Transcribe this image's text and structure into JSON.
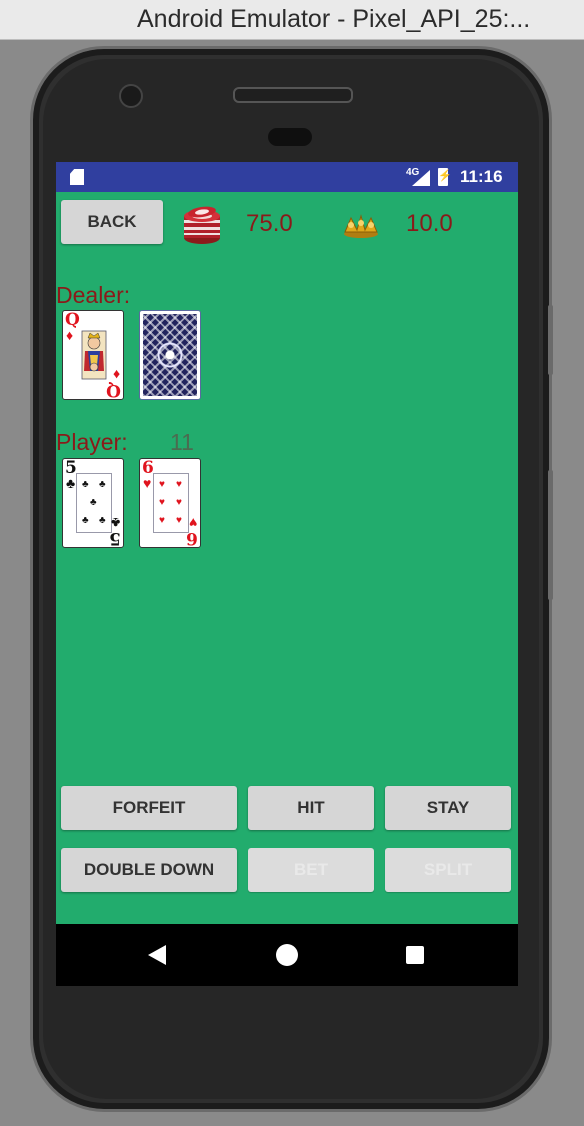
{
  "window": {
    "title": "Android Emulator - Pixel_API_25:..."
  },
  "statusbar": {
    "network": "4G",
    "time": "11:16"
  },
  "header": {
    "back_label": "BACK",
    "money": "75.0",
    "bet": "10.0",
    "chips_icon": "poker-chips-icon",
    "bet_icon": "gold-coins-icon"
  },
  "dealer": {
    "label": "Dealer:",
    "cards": [
      {
        "rank": "Q",
        "suit": "♦",
        "color": "red",
        "face_up": true
      },
      {
        "face_up": false
      }
    ]
  },
  "player": {
    "label": "Player:",
    "score": "11",
    "cards": [
      {
        "rank": "5",
        "suit": "♣",
        "color": "black",
        "face_up": true
      },
      {
        "rank": "6",
        "suit": "♥",
        "color": "red",
        "face_up": true
      }
    ]
  },
  "actions": {
    "forfeit": "FORFEIT",
    "hit": "HIT",
    "stay": "STAY",
    "double_down": "DOUBLE DOWN",
    "bet": "BET",
    "split": "SPLIT"
  },
  "navbar": {
    "back_icon": "nav-back-icon",
    "home_icon": "nav-home-icon",
    "recent_icon": "nav-recents-icon"
  },
  "colors": {
    "table": "#22ac6d",
    "statusbar": "#303f9f",
    "text_dark_red": "#8b1a1a"
  }
}
